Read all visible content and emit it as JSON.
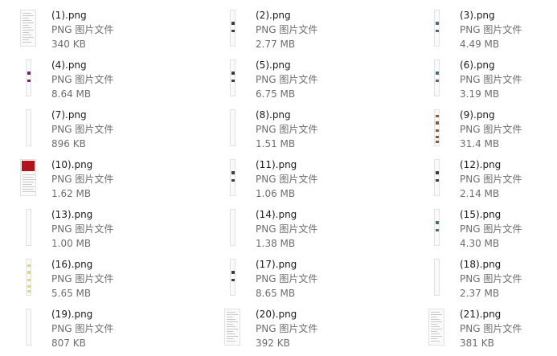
{
  "files": [
    {
      "name": "(1).png",
      "type": "PNG 图片文件",
      "size": "340 KB",
      "thumb": "doc-text"
    },
    {
      "name": "(2).png",
      "type": "PNG 图片文件",
      "size": "2.77 MB",
      "thumb": "narrow-gray"
    },
    {
      "name": "(3).png",
      "type": "PNG 图片文件",
      "size": "4.49 MB",
      "thumb": "narrow-photo"
    },
    {
      "name": "(4).png",
      "type": "PNG 图片文件",
      "size": "8.64 MB",
      "thumb": "narrow-purple"
    },
    {
      "name": "(5).png",
      "type": "PNG 图片文件",
      "size": "6.75 MB",
      "thumb": "narrow-dark"
    },
    {
      "name": "(6).png",
      "type": "PNG 图片文件",
      "size": "3.19 MB",
      "thumb": "narrow-teal"
    },
    {
      "name": "(7).png",
      "type": "PNG 图片文件",
      "size": "896 KB",
      "thumb": "narrow-light"
    },
    {
      "name": "(8).png",
      "type": "PNG 图片文件",
      "size": "1.51 MB",
      "thumb": "narrow-light"
    },
    {
      "name": "(9).png",
      "type": "PNG 图片文件",
      "size": "31.4 MB",
      "thumb": "narrow-brown"
    },
    {
      "name": "(10).png",
      "type": "PNG 图片文件",
      "size": "1.62 MB",
      "thumb": "doc-red"
    },
    {
      "name": "(11).png",
      "type": "PNG 图片文件",
      "size": "1.06 MB",
      "thumb": "narrow-gray"
    },
    {
      "name": "(12).png",
      "type": "PNG 图片文件",
      "size": "2.14 MB",
      "thumb": "narrow-dark"
    },
    {
      "name": "(13).png",
      "type": "PNG 图片文件",
      "size": "1.00 MB",
      "thumb": "narrow-light"
    },
    {
      "name": "(14).png",
      "type": "PNG 图片文件",
      "size": "1.38 MB",
      "thumb": "narrow-light"
    },
    {
      "name": "(15).png",
      "type": "PNG 图片文件",
      "size": "4.30 MB",
      "thumb": "narrow-photo"
    },
    {
      "name": "(16).png",
      "type": "PNG 图片文件",
      "size": "5.65 MB",
      "thumb": "narrow-yellow"
    },
    {
      "name": "(17).png",
      "type": "PNG 图片文件",
      "size": "8.65 MB",
      "thumb": "narrow-dark"
    },
    {
      "name": "(18).png",
      "type": "PNG 图片文件",
      "size": "2.37 MB",
      "thumb": "narrow-light"
    },
    {
      "name": "(19).png",
      "type": "PNG 图片文件",
      "size": "807 KB",
      "thumb": "narrow-light"
    },
    {
      "name": "(20).png",
      "type": "PNG 图片文件",
      "size": "392 KB",
      "thumb": "doc-text"
    },
    {
      "name": "(21).png",
      "type": "PNG 图片文件",
      "size": "381 KB",
      "thumb": "doc-text"
    }
  ],
  "colors": {
    "name": "#1a1a1a",
    "secondary": "#6d6d6d",
    "thumb_border": "#e1e1e1",
    "red_accent": "#b3121d",
    "purple_accent": "#6b2a6e",
    "dark_accent": "#3d3d3d",
    "teal_accent": "#4a6f78",
    "brown_accent": "#8a5a3c",
    "yellow_accent": "#e2d28a"
  }
}
